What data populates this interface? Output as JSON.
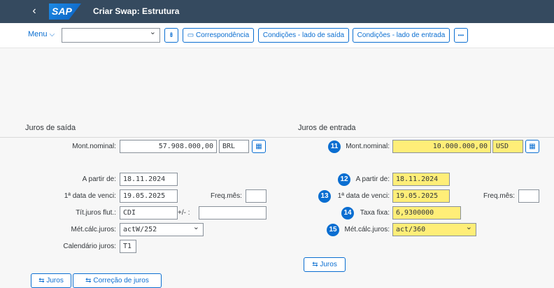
{
  "app": {
    "back_glyph": "‹",
    "logo_text": "SAP",
    "title": "Criar Swap: Estrutura"
  },
  "toolbar": {
    "menu_label": "Menu",
    "menu_chevron": "⌵",
    "menu_select_value": "",
    "struct_icon": "⇟",
    "correspondencia": "Correspondência",
    "cond_saida": "Condições - lado de saída",
    "cond_entrada": "Condições - lado de entrada",
    "overflow": "•••",
    "doc_icon": "▭"
  },
  "left": {
    "section_title": "Juros de saída",
    "mont_label": "Mont.nominal:",
    "mont_value": "57.908.000,00",
    "currency": "BRL",
    "apartir_label": "A partir de:",
    "apartir_value": "18.11.2024",
    "venci_label": "1ª data de venci:",
    "venci_value": "19.05.2025",
    "freq_label": "Freq.mês:",
    "freq_value": "",
    "titjuros_label": "Tít.juros flut.:",
    "titjuros_value": "CDI",
    "plusminus_label": "+/- :",
    "plusminus_value": "",
    "metcalc_label": "Mét.cálc.juros:",
    "metcalc_value": "actW/252",
    "calendario_label": "Calendário juros:",
    "calendario_value": "T1",
    "juros_btn": "Juros",
    "correcao_btn": "Correção de juros"
  },
  "right": {
    "section_title": "Juros de entrada",
    "mont_label": "Mont.nominal:",
    "mont_value": "10.000.000,00",
    "currency": "USD",
    "apartir_label": "A partir de:",
    "apartir_value": "18.11.2024",
    "venci_label": "1ª data de venci:",
    "venci_value": "19.05.2025",
    "freq_label": "Freq.mês:",
    "freq_value": "",
    "taxa_label": "Taxa fixa:",
    "taxa_value": "6,9300000",
    "metcalc_label": "Mét.cálc.juros:",
    "metcalc_value": "act/360",
    "juros_btn": "Juros",
    "badges": [
      "11",
      "12",
      "13",
      "14",
      "15"
    ]
  },
  "icons": {
    "juros_icon": "⇆",
    "matchcode_icon": "▦"
  },
  "colors": {
    "shell": "#354a5f",
    "accent": "#0a6ed1",
    "highlight": "#ffee78"
  }
}
